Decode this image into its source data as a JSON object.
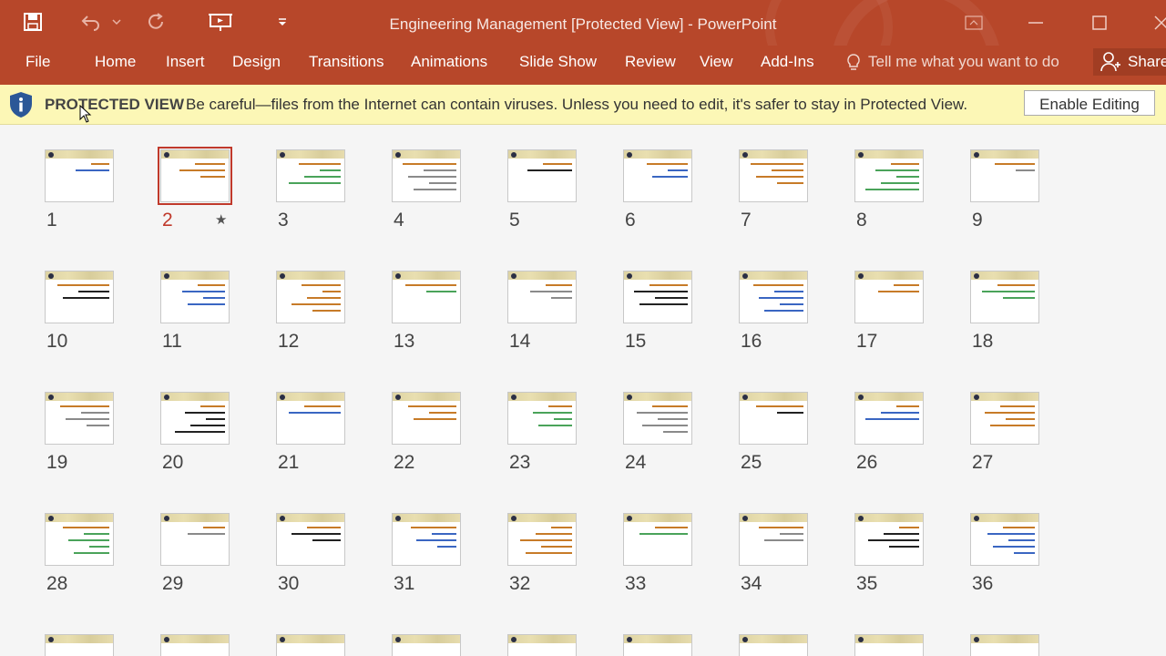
{
  "window": {
    "title": "Engineering Management [Protected View] - PowerPoint"
  },
  "ribbon": {
    "file": "File",
    "tabs": [
      "Home",
      "Insert",
      "Design",
      "Transitions",
      "Animations",
      "Slide Show",
      "Review",
      "View",
      "Add-Ins"
    ],
    "tell_me": "Tell me what you want to do",
    "share": "Share"
  },
  "protected_view": {
    "title": "PROTECTED VIEW",
    "message": "Be careful—files from the Internet can contain viruses. Unless you need to edit, it's safer to stay in Protected View.",
    "enable_button": "Enable Editing"
  },
  "slides": {
    "selected": "2",
    "numbers": [
      "1",
      "2",
      "3",
      "4",
      "5",
      "6",
      "7",
      "8",
      "9",
      "10",
      "11",
      "12",
      "13",
      "14",
      "15",
      "16",
      "17",
      "18",
      "19",
      "20",
      "21",
      "22",
      "23",
      "24",
      "25",
      "26",
      "27",
      "28",
      "29",
      "30",
      "31",
      "32",
      "33",
      "34",
      "35",
      "36"
    ]
  },
  "colors": {
    "accent": "#b7472a",
    "protected_bar": "#fcf7b6",
    "selected_outline": "#c0392b"
  }
}
